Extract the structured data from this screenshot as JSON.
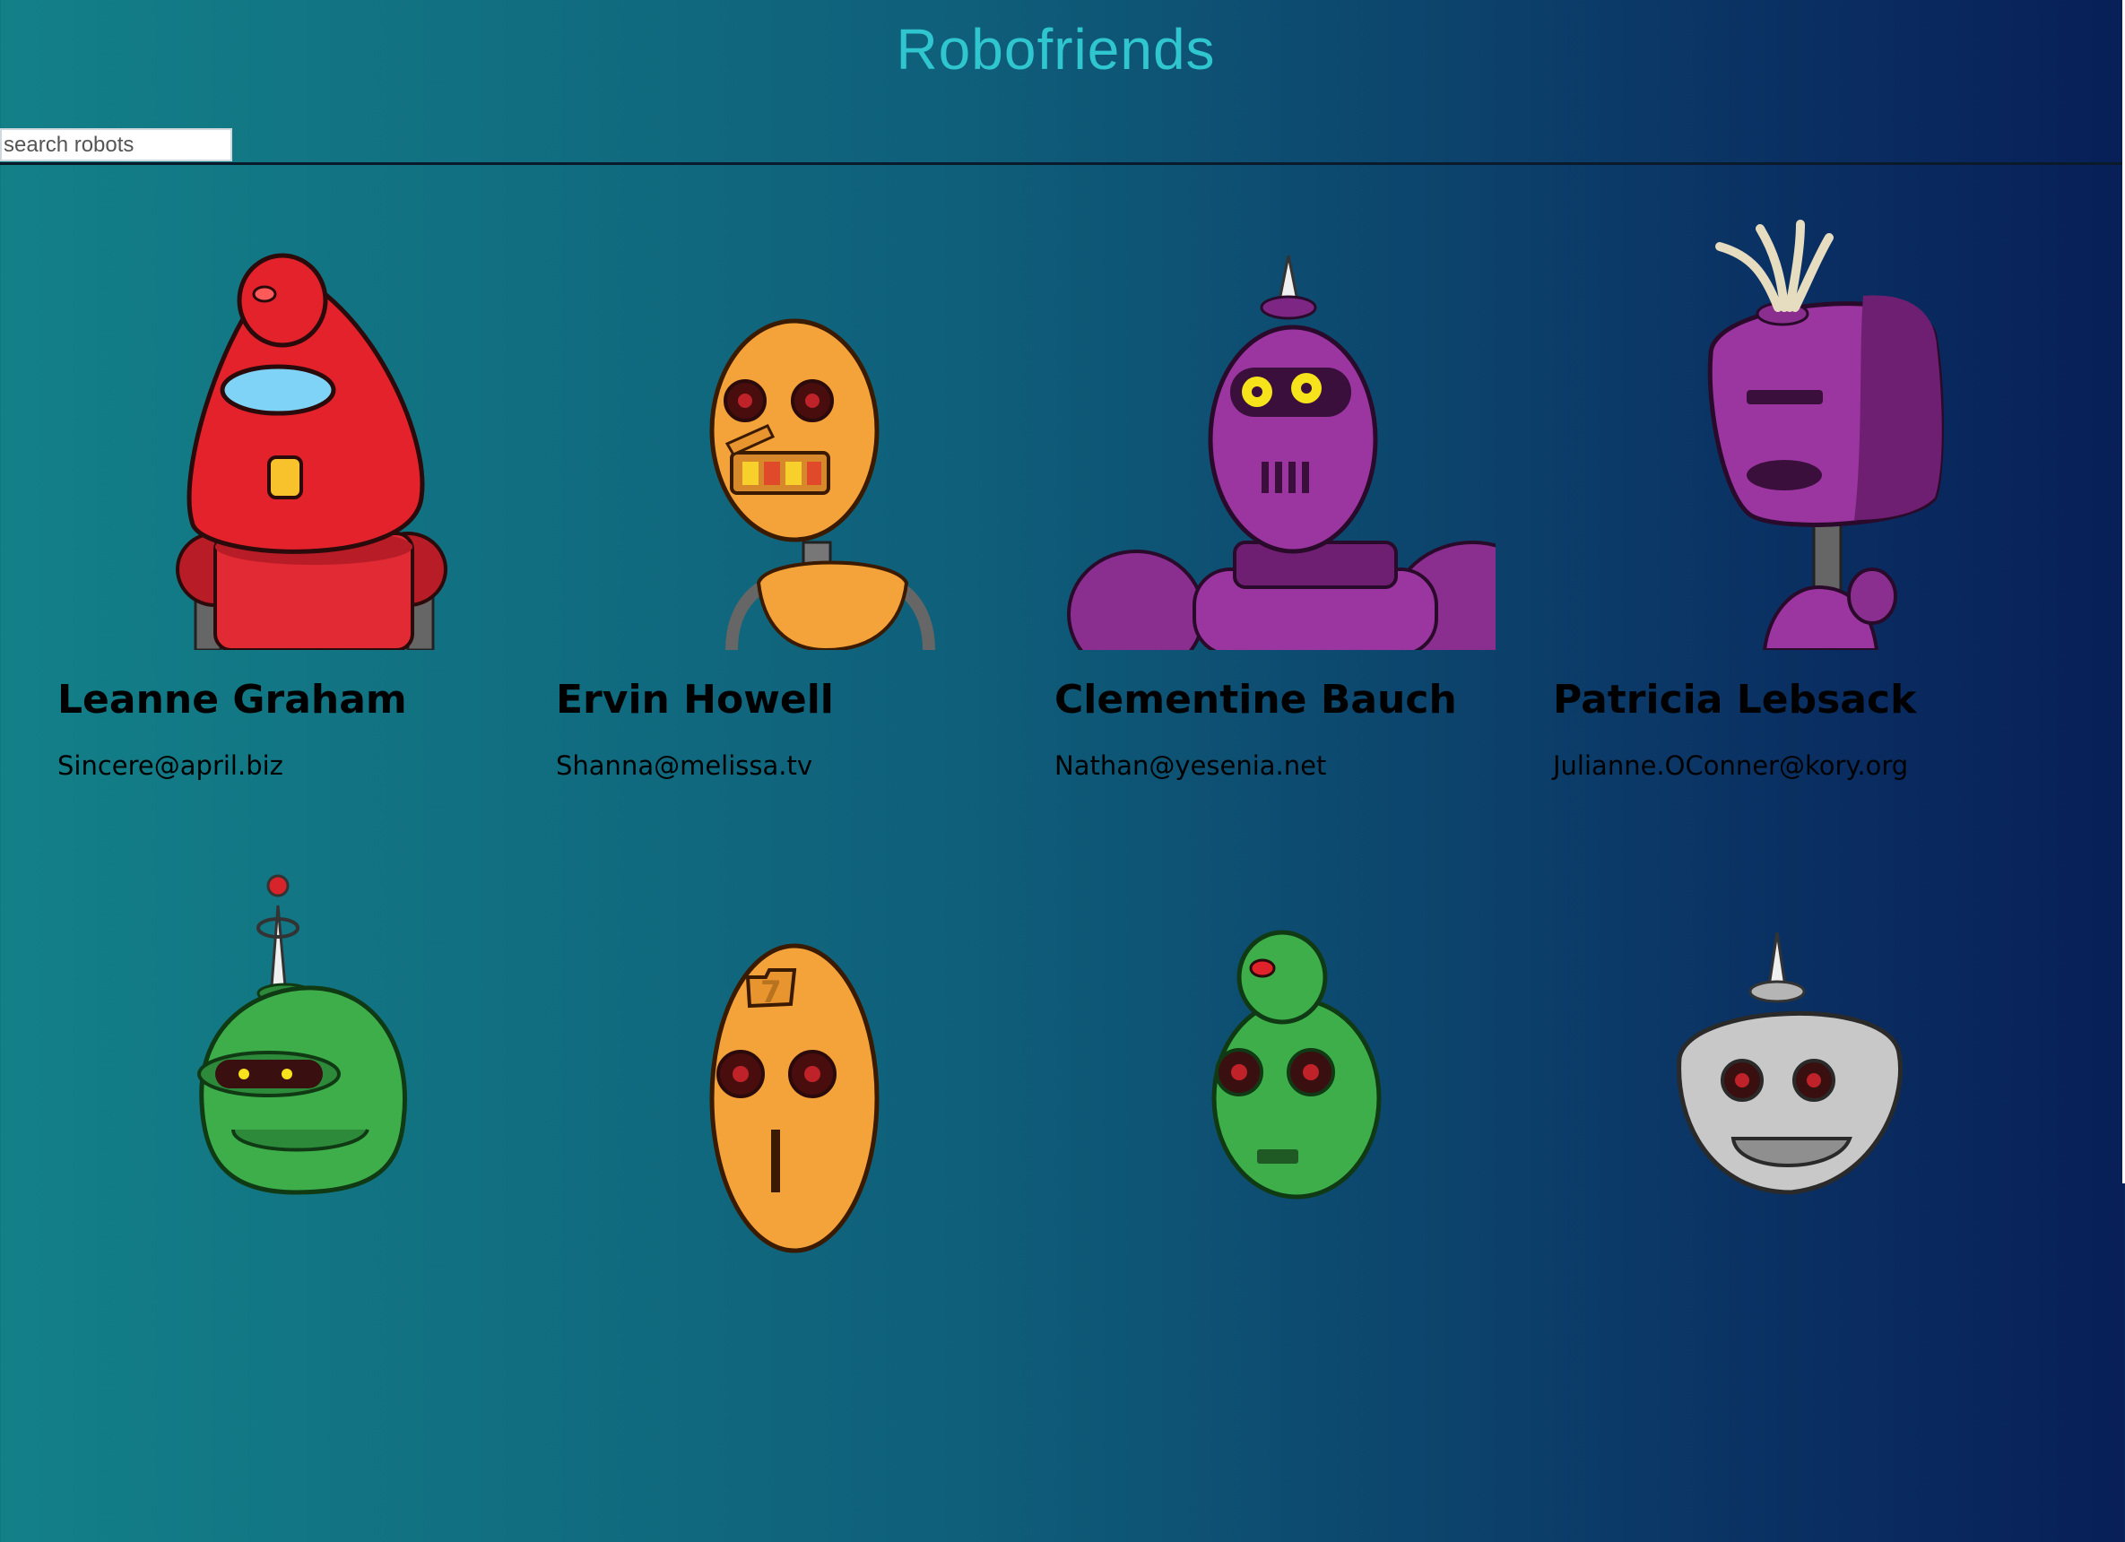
{
  "app": {
    "title": "Robofriends"
  },
  "search": {
    "placeholder": "search robots",
    "value": ""
  },
  "robots": [
    {
      "name": "Leanne Graham",
      "email": "Sincere@april.biz",
      "avatar_icon": "red-robot-avatar-icon"
    },
    {
      "name": "Ervin Howell",
      "email": "Shanna@melissa.tv",
      "avatar_icon": "orange-robot-avatar-icon"
    },
    {
      "name": "Clementine Bauch",
      "email": "Nathan@yesenia.net",
      "avatar_icon": "purple-robot-avatar-icon"
    },
    {
      "name": "Patricia Lebsack",
      "email": "Julianne.OConner@kory.org",
      "avatar_icon": "purple-robot-avatar-icon"
    },
    {
      "avatar_icon": "green-robot-avatar-icon"
    },
    {
      "avatar_icon": "orange-robot-avatar-icon"
    },
    {
      "avatar_icon": "green-robot-avatar-icon"
    },
    {
      "avatar_icon": "gray-robot-avatar-icon"
    }
  ],
  "colors": {
    "background_start": "#138088",
    "background_end": "#081f57",
    "title": "#2fc6cf",
    "text": "#000000"
  }
}
